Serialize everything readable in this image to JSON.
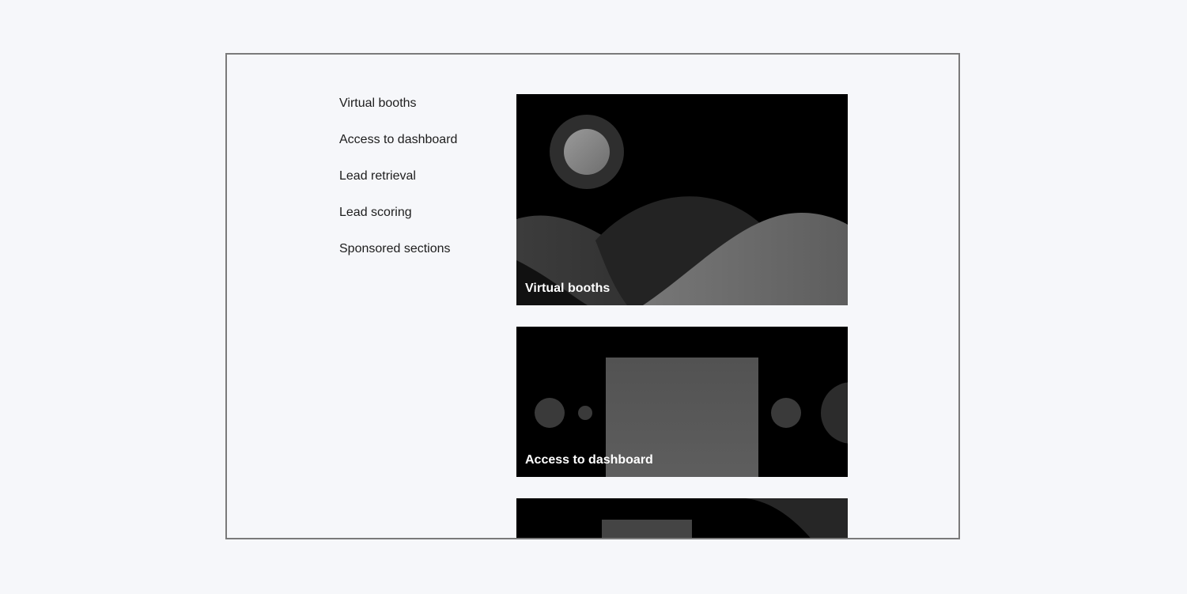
{
  "nav": {
    "items": [
      {
        "label": "Virtual booths"
      },
      {
        "label": "Access to dashboard"
      },
      {
        "label": "Lead retrieval"
      },
      {
        "label": "Lead scoring"
      },
      {
        "label": "Sponsored sections"
      }
    ]
  },
  "cards": [
    {
      "label": "Virtual booths",
      "icon": "landscape-illustration"
    },
    {
      "label": "Access to dashboard",
      "icon": "dashboard-illustration"
    },
    {
      "label": "",
      "icon": "abstract-illustration"
    }
  ],
  "colors": {
    "background": "#f6f7fa",
    "frame_border": "#7a7a7a",
    "card_bg": "#000000",
    "nav_text": "#1d1d1d",
    "card_text": "#ffffff"
  }
}
